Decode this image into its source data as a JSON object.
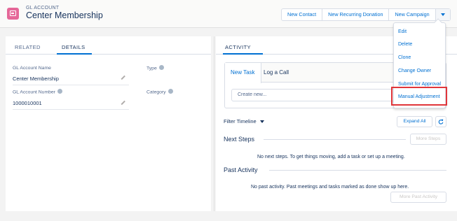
{
  "header": {
    "object_type": "GL ACCOUNT",
    "record_name": "Center Membership",
    "buttons": [
      "New Contact",
      "New Recurring Donation",
      "New Campaign"
    ]
  },
  "left": {
    "tabs": [
      "RELATED",
      "DETAILS"
    ],
    "active_tab": "DETAILS",
    "fields": {
      "gl_name_label": "GL Account Name",
      "gl_name_value": "Center Membership",
      "type_label": "Type",
      "gl_number_label": "GL Account Number",
      "gl_number_value": "1000010001",
      "category_label": "Category"
    }
  },
  "activity": {
    "tab_label": "ACTIVITY",
    "new_task": "New Task",
    "log_call": "Log a Call",
    "input_placeholder": "Create new...",
    "filter": "Filter Timeline",
    "expand_all": "Expand All",
    "next_steps_title": "Next Steps",
    "more_steps": "More Steps",
    "next_steps_empty": "No next steps. To get things moving, add a task or set up a meeting.",
    "past_activity_title": "Past Activity",
    "past_activity_empty": "No past activity. Past meetings and tasks marked as done show up here.",
    "more_past": "More Past Activity"
  },
  "dropdown": {
    "items": [
      "Edit",
      "Delete",
      "Clone",
      "Change Owner",
      "Submit for Approval",
      "Manual Adjustment"
    ],
    "highlighted": "Manual Adjustment"
  },
  "colors": {
    "brand": "#0070d2",
    "object_icon": "#e56798",
    "highlight": "#e0353a"
  }
}
